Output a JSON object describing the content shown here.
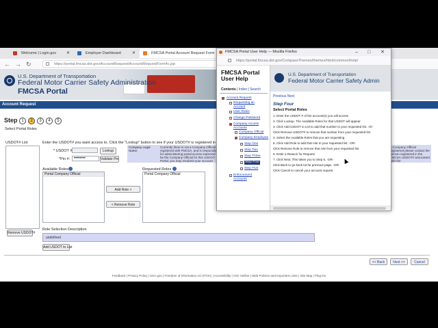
{
  "browser": {
    "tabs": [
      {
        "label": "Welcome | Login.gov",
        "color": "#c0392b"
      },
      {
        "label": "Employer Dashboard",
        "color": "#2b6cb0"
      },
      {
        "label": "FMCSA Portal Account Request Form",
        "color": "#e67e22"
      }
    ],
    "url": "https://portal.fmcsa.dot.gov/AccountRequest/AccountRequestForm4c.jsp"
  },
  "header": {
    "dept_line1": "U.S. Department of Transportation",
    "dept_line2": "Federal Motor Carrier Safety Administration",
    "portal_title": "FMCSA Portal"
  },
  "page": {
    "section_title": "Account Request",
    "step_label": "Step",
    "steps": [
      "1",
      "2",
      "3",
      "4",
      "5"
    ],
    "current_step": 2,
    "subtitle": "Select Portal Roles",
    "usdot_list_label": "USDOT# List",
    "instructions": "Enter the USDOT# you want access to. Click the \"Lookup\" button to see if your USDOT# is registered in our system.",
    "usdot_field_label": "* USDOT #:",
    "usdot_value": "",
    "pin_field_label": "*Pin #:",
    "pin_value": "••••••••",
    "lookup_button": "Lookup",
    "validate_button": "Validate Pin",
    "company_legal_name_label": "Company Legal Name:",
    "info_text": "Currently there is not a Company Official registered with FMCSA, and is responsible for administering portal access expected to be the Company Official for this USDOT. Portal, you may resubmit your account request USDOT# for which you are requesting access.",
    "info_text_right": "a Company Official registered please contact the person registered in the FMCSA USDOT# associated with the",
    "available_roles_label": "Available Roles",
    "available_roles": [
      "Portal Company Official"
    ],
    "requested_roles_label": "Requested Roles",
    "requested_roles": [
      "Portal Company Official"
    ],
    "add_role_button": "Add Role >",
    "remove_role_button": "< Remove Role",
    "remove_usdot_button": "Remove USDOT#",
    "role_selection_label": "Role Selection Description",
    "role_selection_value": "undefined",
    "add_usdot_button": "Add USDOT to List",
    "back_button": "<< Back",
    "next_button": "Next >>",
    "cancel_button": "Cancel",
    "footer": "Feedback | Privacy Policy | USA.gov | Freedom of Information Act (FOIA) | Accessibility | OIG Hotline | Web Policies and Important Links | Site Map | Plug-ins"
  },
  "popup": {
    "window_title": "FMCSA Portal User Help — Mozilla Firefox",
    "url": "https://portal.fmcsa.dot.gov/CompassThemes/themes/html/common/help/",
    "help_title": "FMCSA Portal User Help",
    "tabs": {
      "contents": "Contents",
      "index": "Index",
      "search": "Search"
    },
    "tree": [
      "Account Request",
      "Requesting an Account",
      "User Roles",
      "Change Password",
      "Company Access Accounts",
      "Company Official",
      "Company Employee",
      "Step One",
      "Step Two",
      "Step Three",
      "Step Four",
      "Step Five",
      "Enforcement Accounts"
    ],
    "banner_line1": "U.S. Department of Transportation",
    "banner_line2": "Federal Motor Carrier Safety Admin",
    "nav": "Previous  Next",
    "step_heading": "Step Four",
    "section_heading": "Select Portal Roles",
    "instructions": [
      "1. Enter the USDOT # of the account(s) you will access",
      "2. Click Lookup. The Available Roles for that USDOT will appear",
      "3. Click Add USDOT to List to add that number to your requested list. -Or-",
      "   Click Remove USDOT# to remove that number from your requested list",
      "4. Select the Available Roles that you are requesting",
      "5. Click Add Role to add that role to your requested list. -OR-",
      "   Click Remove Role to remove that role from your requested list",
      "6. Enter a Reason for Request",
      "7. Click Next. This takes you to Step 5. -OR-",
      "   Click Back to go back tot he previous page. -OR-",
      "   Click Cancel to cancel your account request"
    ]
  }
}
